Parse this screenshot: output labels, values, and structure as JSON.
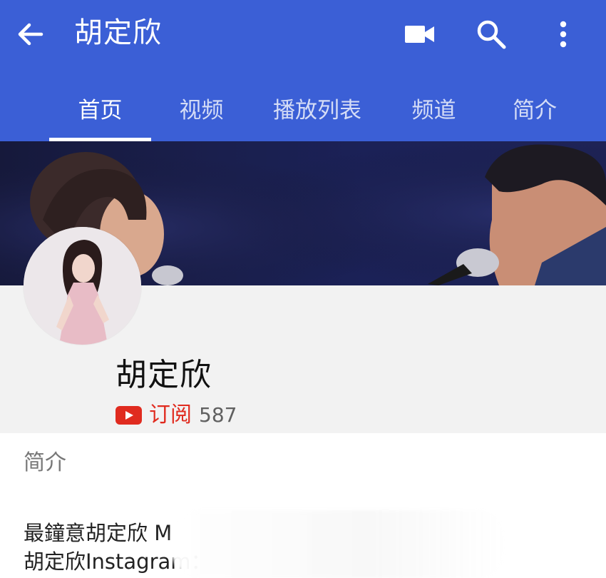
{
  "toolbar": {
    "back_icon": "arrow-back-icon",
    "title": "胡定欣",
    "camera_icon": "video-camera-icon",
    "search_icon": "search-icon",
    "more_icon": "more-vert-icon"
  },
  "tabs": [
    {
      "label": "首页",
      "active": true
    },
    {
      "label": "视频",
      "active": false
    },
    {
      "label": "播放列表",
      "active": false
    },
    {
      "label": "频道",
      "active": false
    },
    {
      "label": "简介",
      "active": false
    }
  ],
  "channel": {
    "name": "胡定欣",
    "subscribe_label": "订阅",
    "subscriber_count": "587"
  },
  "about": {
    "title": "简介",
    "lines": [
      "最鐘意胡定欣 M",
      "胡定欣Instagram："
    ]
  },
  "colors": {
    "appbar": "#3b5fd6",
    "subscribe": "#e02b1f",
    "header_bg": "#f2f2f2"
  }
}
